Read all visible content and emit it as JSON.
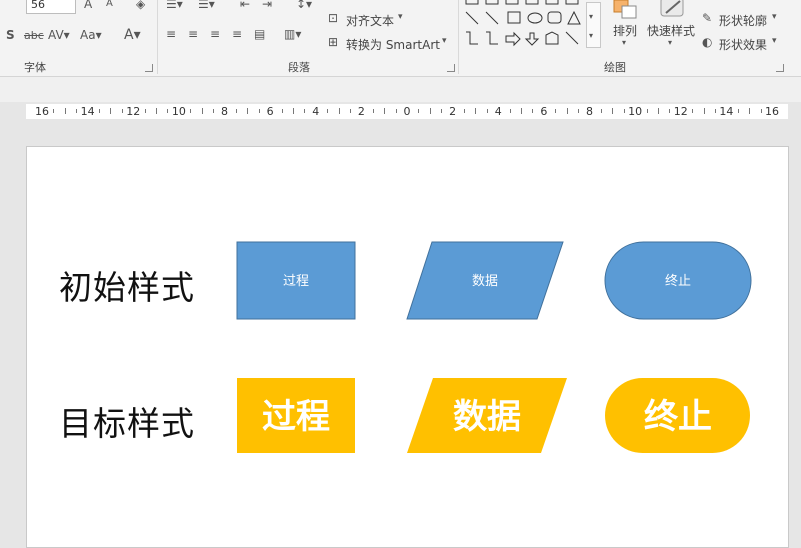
{
  "ribbon": {
    "font_size_value": "56",
    "font_group_label": "字体",
    "paragraph_group_label": "段落",
    "drawing_group_label": "绘图",
    "align_text_label": "对齐文本",
    "convert_smartart_label": "转换为 SmartArt",
    "arrange_label": "排列",
    "quick_styles_label": "快速样式",
    "shape_outline_label": "形状轮廓",
    "shape_effects_label": "形状效果"
  },
  "ruler": {
    "labels": [
      "16",
      "14",
      "12",
      "10",
      "8",
      "6",
      "4",
      "2",
      "0",
      "2",
      "4",
      "6",
      "8",
      "10",
      "12",
      "14",
      "16"
    ]
  },
  "slide": {
    "row1_label": "初始样式",
    "row2_label": "目标样式",
    "initial": {
      "process": "过程",
      "data": "数据",
      "terminator": "终止",
      "fill": "#5b9bd5",
      "stroke": "#41719c"
    },
    "target": {
      "process": "过程",
      "data": "数据",
      "terminator": "终止",
      "fill": "#ffc000"
    }
  }
}
